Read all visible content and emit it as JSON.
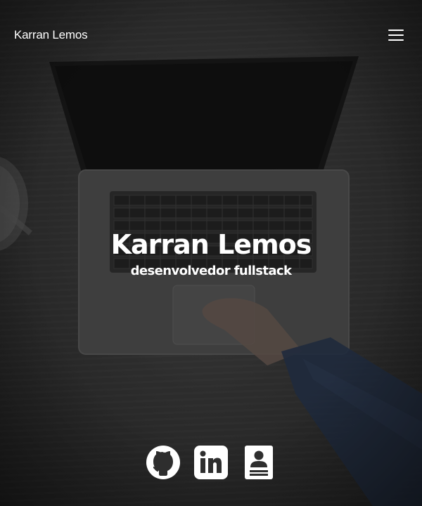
{
  "header": {
    "brand": "Karran Lemos",
    "menu_icon": "hamburger-menu-icon"
  },
  "hero": {
    "title": "Karran Lemos",
    "subtitle": "desenvolvedor fullstack"
  },
  "socials": [
    {
      "name": "GitHub",
      "icon": "github-icon"
    },
    {
      "name": "LinkedIn",
      "icon": "linkedin-icon"
    },
    {
      "name": "Resume",
      "icon": "resume-icon"
    }
  ],
  "colors": {
    "text": "#ffffff",
    "background": "#2a2a2a"
  }
}
